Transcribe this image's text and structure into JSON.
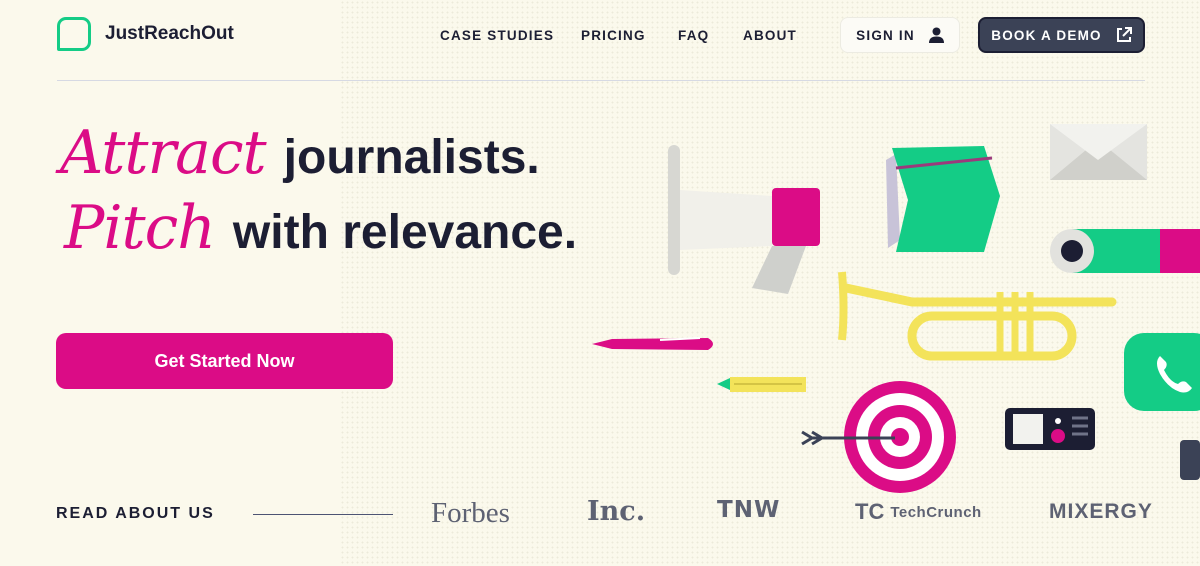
{
  "brand": {
    "name": "JustReachOut",
    "logo_icon": "chat-bubble-icon",
    "accent": "#14cc86"
  },
  "nav": {
    "case_studies": "CASE STUDIES",
    "pricing": "PRICING",
    "faq": "FAQ",
    "about": "ABOUT",
    "sign_in": "SIGN IN",
    "book_demo": "BOOK A DEMO"
  },
  "hero": {
    "line1_script": "Attract",
    "line1_bold": "journalists.",
    "line2_script": "Pitch",
    "line2_bold": "with relevance.",
    "cta": "Get Started Now"
  },
  "press": {
    "label": "READ ABOUT US",
    "logos": [
      "Forbes",
      "Inc.",
      "TNW",
      "TechCrunch",
      "MIXERGY"
    ],
    "techcrunch_mark": "TC"
  },
  "colors": {
    "pink": "#db0c86",
    "green": "#14cc86",
    "navy": "#1c1e33",
    "yellow": "#f3e35a",
    "background": "#fbf9ec"
  }
}
